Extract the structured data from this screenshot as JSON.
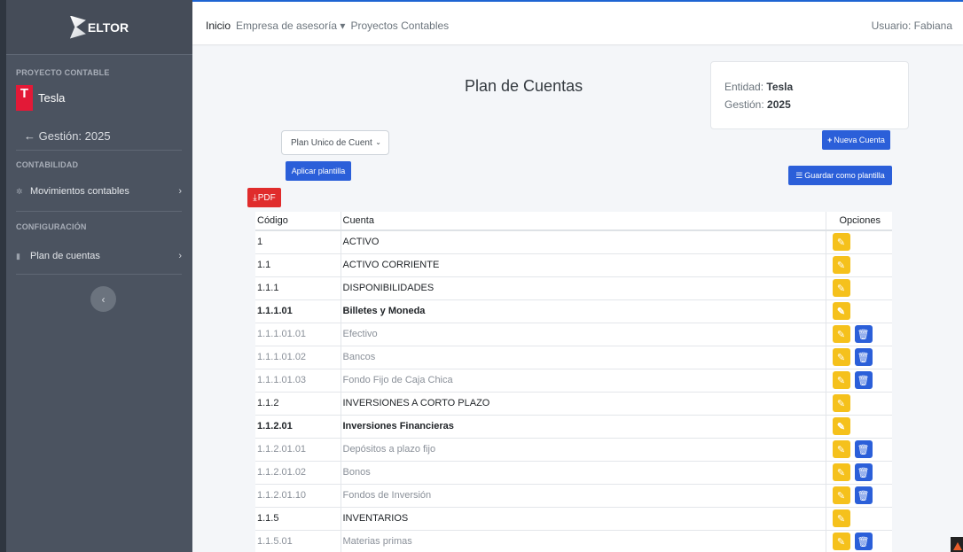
{
  "sidebar": {
    "brand": "ELTOR",
    "section_project": "PROYECTO CONTABLE",
    "project_name": "Tesla",
    "gestion": "Gestión: 2025",
    "section_accounting": "CONTABILIDAD",
    "movements": "Movimientos contables",
    "section_config": "CONFIGURACIÓN",
    "chart_of_accounts": "Plan de cuentas"
  },
  "topnav": {
    "home": "Inicio",
    "company": "Empresa de asesoría",
    "projects": "Proyectos Contables",
    "user": "Usuario: Fabiana"
  },
  "main": {
    "title": "Plan de Cuentas",
    "entity_label": "Entidad:",
    "entity_value": "Tesla",
    "gestion_label": "Gestión:",
    "gestion_value": "2025",
    "template_select": "Plan Unico de Cuent",
    "new_account": "Nueva Cuenta",
    "apply_template": "Aplicar plantilla",
    "save_template": "Guardar como plantilla",
    "pdf": "PDF"
  },
  "table": {
    "headers": [
      "Código",
      "Cuenta",
      "Opciones"
    ],
    "rows": [
      {
        "code": "1",
        "name": "ACTIVO",
        "level": "group",
        "delete": false
      },
      {
        "code": "1.1",
        "name": "ACTIVO CORRIENTE",
        "level": "group",
        "delete": false
      },
      {
        "code": "1.1.1",
        "name": "DISPONIBILIDADES",
        "level": "group",
        "delete": false
      },
      {
        "code": "1.1.1.01",
        "name": "Billetes y Moneda",
        "level": "bold",
        "delete": false
      },
      {
        "code": "1.1.1.01.01",
        "name": "Efectivo",
        "level": "detail",
        "delete": true
      },
      {
        "code": "1.1.1.01.02",
        "name": "Bancos",
        "level": "detail",
        "delete": true
      },
      {
        "code": "1.1.1.01.03",
        "name": "Fondo Fijo de Caja Chica",
        "level": "detail",
        "delete": true
      },
      {
        "code": "1.1.2",
        "name": "INVERSIONES A CORTO PLAZO",
        "level": "group",
        "delete": false
      },
      {
        "code": "1.1.2.01",
        "name": "Inversiones Financieras",
        "level": "bold",
        "delete": false
      },
      {
        "code": "1.1.2.01.01",
        "name": "Depósitos a plazo fijo",
        "level": "detail",
        "delete": true
      },
      {
        "code": "1.1.2.01.02",
        "name": "Bonos",
        "level": "detail",
        "delete": true
      },
      {
        "code": "1.1.2.01.10",
        "name": "Fondos de Inversión",
        "level": "detail",
        "delete": true
      },
      {
        "code": "1.1.5",
        "name": "INVENTARIOS",
        "level": "group",
        "delete": false
      },
      {
        "code": "1.1.5.01",
        "name": "Materias primas",
        "level": "detail",
        "delete": true
      }
    ]
  },
  "colors": {
    "sidebar": "#4b5360",
    "primary": "#2b5fd9",
    "edit": "#f5c11c",
    "pdf": "#e02c2c"
  }
}
